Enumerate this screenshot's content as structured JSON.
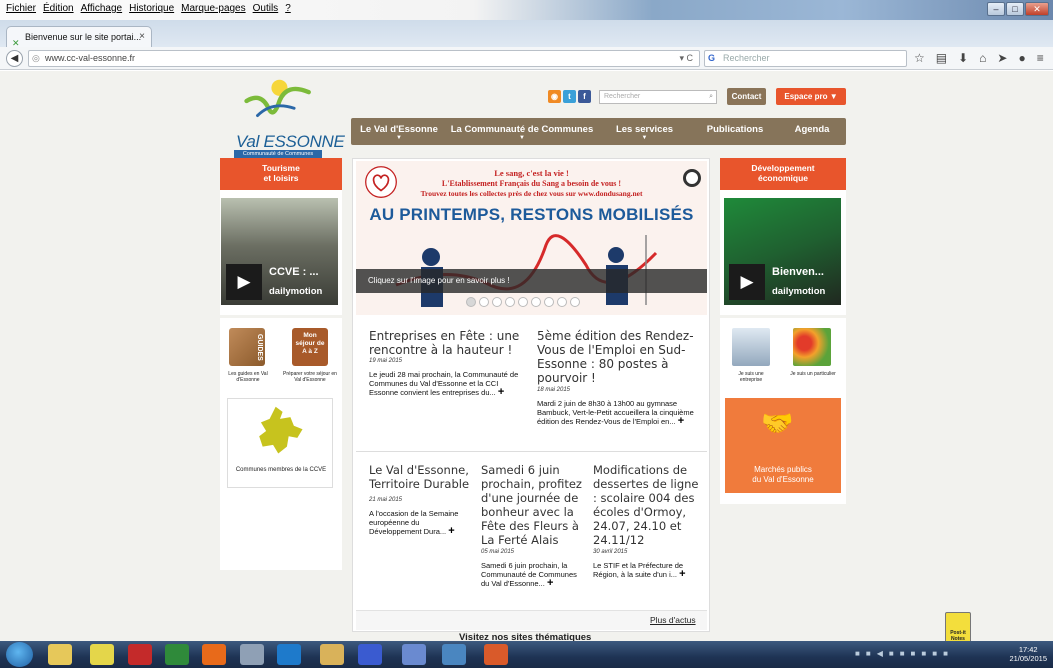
{
  "browser": {
    "menu": [
      "Fichier",
      "Édition",
      "Affichage",
      "Historique",
      "Marque-pages",
      "Outils",
      "?"
    ],
    "tab_title": "Bienvenue sur le site portai...",
    "url": "www.cc-val-essonne.fr",
    "search_placeholder": "Rechercher"
  },
  "site": {
    "logo_text": "Val ESSONNE",
    "logo_subtitle": "Communauté de Communes",
    "search_placeholder": "Rechercher",
    "contact_label": "Contact",
    "espace_pro_label": "Espace pro ▼",
    "nav": [
      {
        "label": "Le Val d'Essonne",
        "arrow": "▼"
      },
      {
        "label": "La Communauté de Communes",
        "arrow": "▼"
      },
      {
        "label": "Les services",
        "arrow": "▼"
      },
      {
        "label": "Publications",
        "arrow": ""
      },
      {
        "label": "Agenda",
        "arrow": ""
      }
    ],
    "left": {
      "header": "Tourisme\net loisirs",
      "video_title": "CCVE : ...",
      "video_brand": "dailymotion",
      "guides_label": "Les guides en Val d'Essonne",
      "sejour_label": "Préparer votre séjour en Val d'Essonne",
      "sejour_icon_text": "Mon séjour de A à Z",
      "guides_icon_text": "GUIDES",
      "communes_label": "Communes membres de la CCVE"
    },
    "banner": {
      "line1": "Le sang, c'est la vie !",
      "line2": "L'Etablissement Français du Sang a besoin de vous !",
      "line3": "Trouvez toutes les collectes près de chez vous sur www.dondusang.net",
      "headline": "AU PRINTEMPS, RESTONS MOBILISÉS",
      "caption": "Cliquez sur l'image pour en savoir plus !",
      "dots": 9,
      "active_dot": 0
    },
    "news_top": [
      {
        "title": "Entreprises en Fête : une rencontre à la hauteur !",
        "date": "19 mai 2015",
        "body": "Le jeudi 28 mai prochain, la Communauté de Communes du Val d'Essonne et la CCI Essonne convient les entreprises du..."
      },
      {
        "title": "5ème édition des Rendez-Vous de l'Emploi en Sud-Essonne : 80 postes à pourvoir !",
        "date": "18 mai 2015",
        "body": "Mardi 2 juin de 8h30 à 13h00 au gymnase Bambuck, Vert-le-Petit accueillera la cinquième édition des Rendez-Vous de l'Emploi en..."
      }
    ],
    "news_bottom": [
      {
        "title": "Le Val d'Essonne, Territoire Durable",
        "date": "21 mai 2015",
        "body": "A l'occasion de la Semaine européenne du Développement Dura..."
      },
      {
        "title": "Samedi 6 juin prochain, profitez d'une journée de bonheur avec la Fête des Fleurs à La Ferté Alais",
        "date": "05 mai 2015",
        "body": "Samedi 6 juin prochain, la Communauté de Communes du Val d'Essonne..."
      },
      {
        "title": "Modifications de dessertes de ligne : scolaire 004 des écoles d'Ormoy, 24.07, 24.10 et 24.11/12",
        "date": "30 avril 2015",
        "body": "Le STIF et la Préfecture de Région, à la suite d'un i..."
      }
    ],
    "plus_actus": "Plus d'actus",
    "visitez": "Visitez nos sites thématiques",
    "right": {
      "header": "Développement\néconomique",
      "video_title": "Bienven...",
      "video_brand": "dailymotion",
      "entreprise_label": "Je suis une entreprise",
      "particulier_label": "Je suis un particulier",
      "marches_label": "Marchés publics\ndu Val d'Essonne"
    },
    "postit": "Post-it Notes"
  },
  "taskbar": {
    "time": "17:42",
    "date": "21/05/2015"
  },
  "colors": {
    "orange": "#e8552c",
    "nav_brown": "#86745a",
    "link_blue": "#1d5a9a"
  }
}
